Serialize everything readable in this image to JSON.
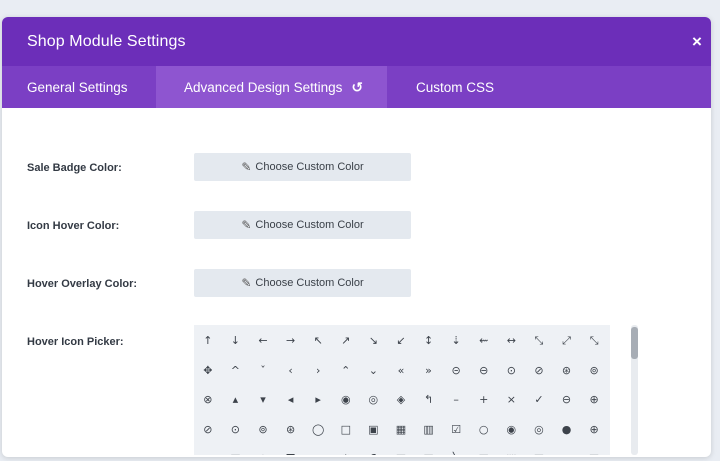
{
  "modal": {
    "title": "Shop Module Settings",
    "close_glyph": "×"
  },
  "tabs": [
    {
      "label": "General Settings",
      "active": false
    },
    {
      "label": "Advanced Design Settings",
      "active": true,
      "reset_glyph": "↺"
    },
    {
      "label": "Custom CSS",
      "active": false
    }
  ],
  "fields": {
    "sale_badge": {
      "label": "Sale Badge Color:",
      "button": "Choose Custom Color"
    },
    "icon_hover": {
      "label": "Icon Hover Color:",
      "button": "Choose Custom Color"
    },
    "hover_overlay": {
      "label": "Hover Overlay Color:",
      "button": "Choose Custom Color"
    },
    "hover_icon_picker": {
      "label": "Hover Icon Picker:"
    }
  },
  "dropper_glyph": "✎",
  "icons": [
    [
      "↑",
      "↓",
      "←",
      "→",
      "↖",
      "↗",
      "↘",
      "↙",
      "↕",
      "⇣",
      "⇜",
      "↔",
      "⤡",
      "⤢",
      "⤡",
      "⤢"
    ],
    [
      "✥",
      "^",
      "ˇ",
      "‹",
      "›",
      "⌃",
      "⌄",
      "«",
      "»",
      "⊝",
      "⊖",
      "⊙",
      "⊘",
      "⊛",
      "⊚",
      "⊜"
    ],
    [
      "⊗",
      "▴",
      "▾",
      "◂",
      "▸",
      "◉",
      "◎",
      "◈",
      "↰",
      "–",
      "+",
      "×",
      "✓",
      "⊖",
      "⊕",
      "⊗"
    ],
    [
      "⊘",
      "⊙",
      "⊚",
      "⊛",
      "◯",
      "□",
      "▣",
      "▦",
      "▥",
      "☑",
      "○",
      "◉",
      "◎",
      "●",
      "⊕",
      "»"
    ],
    [
      "≡",
      "▤",
      "◍",
      "☰",
      "≣",
      "⚖",
      "⚗",
      "▧",
      "▨",
      "╲",
      "◪",
      "⬚",
      "◰",
      "▬",
      "◫",
      "ⓘ"
    ]
  ],
  "colors": {
    "header": "#6c2eb9",
    "tabs": "#7b3fc4",
    "active_tab": "#8e55d0",
    "button_bg": "#e4e9ef"
  }
}
